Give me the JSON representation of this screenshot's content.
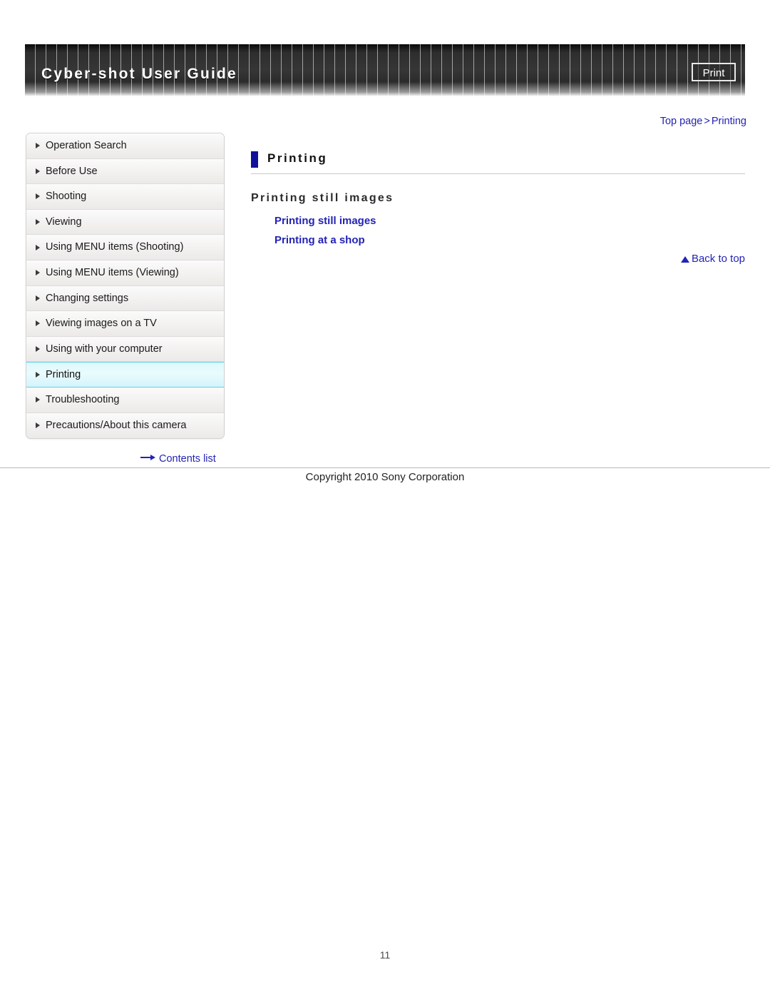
{
  "header": {
    "title": "Cyber-shot User Guide",
    "print_label": "Print"
  },
  "breadcrumb": {
    "top_page": "Top page",
    "separator": ">",
    "current": "Printing"
  },
  "sidebar": {
    "items": [
      {
        "label": "Operation Search",
        "active": false
      },
      {
        "label": "Before Use",
        "active": false
      },
      {
        "label": "Shooting",
        "active": false
      },
      {
        "label": "Viewing",
        "active": false
      },
      {
        "label": "Using MENU items (Shooting)",
        "active": false
      },
      {
        "label": "Using MENU items (Viewing)",
        "active": false
      },
      {
        "label": "Changing settings",
        "active": false
      },
      {
        "label": "Viewing images on a TV",
        "active": false
      },
      {
        "label": "Using with your computer",
        "active": false
      },
      {
        "label": "Printing",
        "active": true
      },
      {
        "label": "Troubleshooting",
        "active": false
      },
      {
        "label": "Precautions/About this camera",
        "active": false
      }
    ],
    "contents_list_label": "Contents list"
  },
  "main": {
    "page_title": "Printing",
    "section_heading": "Printing still images",
    "links": [
      {
        "label": "Printing still images"
      },
      {
        "label": "Printing at a shop"
      }
    ],
    "back_to_top_label": "Back to top"
  },
  "footer": {
    "copyright": "Copyright 2010 Sony Corporation",
    "page_number": "11"
  },
  "colors": {
    "link_blue": "#2323b4",
    "title_marker": "#11119a",
    "active_border": "#63cfe8",
    "banner_dark": "#2b2b2b"
  }
}
